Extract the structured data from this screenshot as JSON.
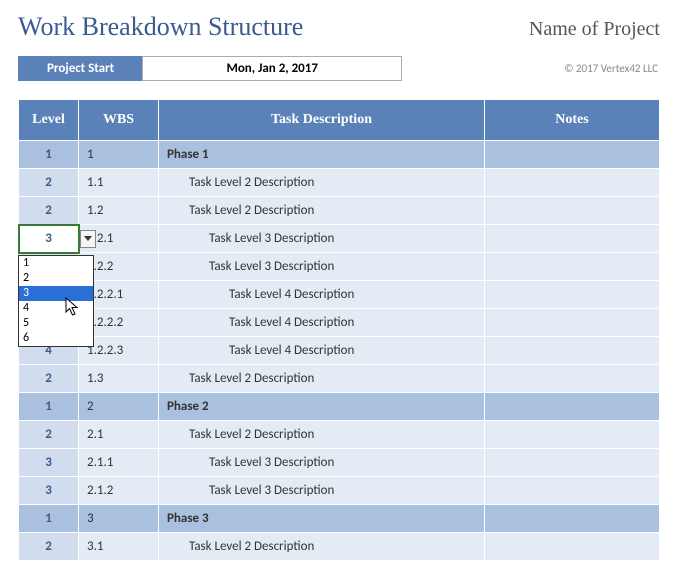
{
  "header": {
    "title": "Work Breakdown Structure",
    "project_name": "Name of Project",
    "project_start_label": "Project Start",
    "project_start_value": "Mon, Jan 2, 2017",
    "copyright": "© 2017 Vertex42 LLC"
  },
  "columns": {
    "level": "Level",
    "wbs": "WBS",
    "desc": "Task Description",
    "notes": "Notes"
  },
  "rows": [
    {
      "level": "1",
      "wbs": "1",
      "desc": "Phase 1",
      "cls": "lvl1"
    },
    {
      "level": "2",
      "wbs": "1.1",
      "desc": "Task Level 2 Description",
      "cls": "lvl2"
    },
    {
      "level": "2",
      "wbs": "1.2",
      "desc": "Task Level 2 Description",
      "cls": "lvl2"
    },
    {
      "level": "3",
      "wbs": "1.2.1",
      "desc": "Task Level 3 Description",
      "cls": "lvl3",
      "active": true
    },
    {
      "level": "",
      "wbs": "1.2.2",
      "desc": "Task Level 3 Description",
      "cls": "lvl3"
    },
    {
      "level": "",
      "wbs": "1.2.2.1",
      "desc": "Task Level 4 Description",
      "cls": "lvl4"
    },
    {
      "level": "",
      "wbs": "1.2.2.2",
      "desc": "Task Level 4 Description",
      "cls": "lvl4"
    },
    {
      "level": "4",
      "wbs": "1.2.2.3",
      "desc": "Task Level 4 Description",
      "cls": "lvl4"
    },
    {
      "level": "2",
      "wbs": "1.3",
      "desc": "Task Level 2 Description",
      "cls": "lvl2"
    },
    {
      "level": "1",
      "wbs": "2",
      "desc": "Phase 2",
      "cls": "lvl1"
    },
    {
      "level": "2",
      "wbs": "2.1",
      "desc": "Task Level 2 Description",
      "cls": "lvl2"
    },
    {
      "level": "3",
      "wbs": "2.1.1",
      "desc": "Task Level 3 Description",
      "cls": "lvl3"
    },
    {
      "level": "3",
      "wbs": "2.1.2",
      "desc": "Task Level 3 Description",
      "cls": "lvl3"
    },
    {
      "level": "1",
      "wbs": "3",
      "desc": "Phase 3",
      "cls": "lvl1"
    },
    {
      "level": "2",
      "wbs": "3.1",
      "desc": "Task Level 2 Description",
      "cls": "lvl2"
    }
  ],
  "dropdown": {
    "options": [
      "1",
      "2",
      "3",
      "4",
      "5",
      "6"
    ],
    "selected": "3"
  }
}
